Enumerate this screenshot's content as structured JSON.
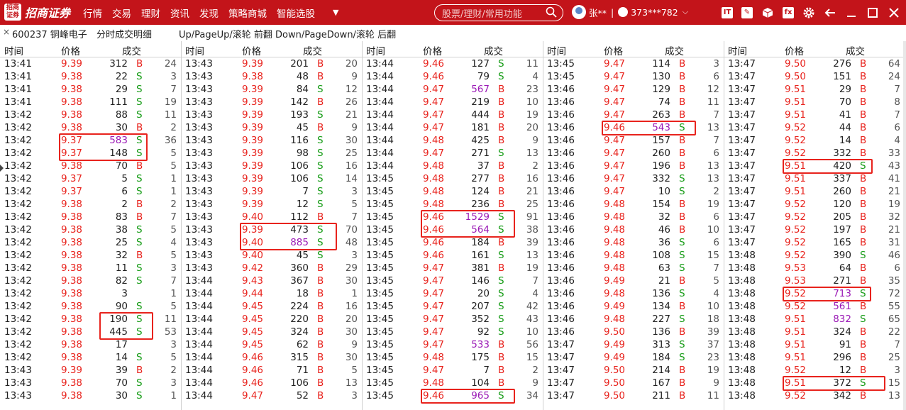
{
  "app": {
    "brand": "招商证券",
    "logo_mark": "招商证券"
  },
  "nav": [
    "行情",
    "交易",
    "理财",
    "资讯",
    "发现",
    "策略商城",
    "智能选股"
  ],
  "search": {
    "placeholder": "股票/理财/常用功能"
  },
  "user": {
    "name": "张**",
    "account": "373***782"
  },
  "toolbar_icons": [
    "it-icon",
    "chart-icon",
    "cube-icon",
    "fx-icon",
    "gear-icon",
    "back-arrow-icon",
    "minimize-icon",
    "maximize-icon",
    "close-icon"
  ],
  "subheader": {
    "close": "×",
    "stock": "600237 铜峰电子",
    "title": "分时成交明细",
    "hint": "Up/PageUp/滚轮 前翻 Down/PageDown/滚轮 后翻"
  },
  "headers": {
    "time": "时间",
    "price": "价格",
    "volume": "成交"
  },
  "colors": {
    "up": "#e8231d",
    "down": "#169c16",
    "large": "#9b1ab6",
    "brand": "#c3141a"
  },
  "panels": [
    {
      "rows": [
        [
          "13:41",
          "9.39",
          "312",
          "B",
          "24"
        ],
        [
          "13:41",
          "9.38",
          "22",
          "S",
          "3"
        ],
        [
          "13:41",
          "9.38",
          "29",
          "S",
          "7"
        ],
        [
          "13:41",
          "9.38",
          "111",
          "S",
          "19"
        ],
        [
          "13:42",
          "9.38",
          "88",
          "S",
          "11"
        ],
        [
          "13:42",
          "9.38",
          "30",
          "B",
          "2"
        ],
        [
          "13:42",
          "9.37",
          "583",
          "S",
          "36"
        ],
        [
          "13:42",
          "9.37",
          "148",
          "S",
          "5"
        ],
        [
          "13:42",
          "9.38",
          "70",
          "B",
          "5"
        ],
        [
          "13:42",
          "9.37",
          "5",
          "S",
          "1"
        ],
        [
          "13:42",
          "9.37",
          "6",
          "S",
          "1"
        ],
        [
          "13:42",
          "9.38",
          "2",
          "B",
          "2"
        ],
        [
          "13:42",
          "9.38",
          "83",
          "B",
          "7"
        ],
        [
          "13:42",
          "9.38",
          "38",
          "S",
          "5"
        ],
        [
          "13:42",
          "9.38",
          "25",
          "S",
          "4"
        ],
        [
          "13:42",
          "9.38",
          "32",
          "B",
          "5"
        ],
        [
          "13:42",
          "9.38",
          "11",
          "S",
          "3"
        ],
        [
          "13:42",
          "9.38",
          "82",
          "S",
          "7"
        ],
        [
          "13:42",
          "9.38",
          "3",
          "",
          "1"
        ],
        [
          "13:42",
          "9.38",
          "90",
          "S",
          "5"
        ],
        [
          "13:42",
          "9.38",
          "190",
          "S",
          "11"
        ],
        [
          "13:42",
          "9.38",
          "445",
          "S",
          "53"
        ],
        [
          "13:42",
          "9.38",
          "17",
          "",
          "3"
        ],
        [
          "13:42",
          "9.38",
          "14",
          "S",
          "5"
        ],
        [
          "13:43",
          "9.39",
          "39",
          "B",
          "2"
        ],
        [
          "13:43",
          "9.38",
          "70",
          "S",
          "3"
        ],
        [
          "13:43",
          "9.38",
          "30",
          "S",
          "1"
        ]
      ]
    },
    {
      "rows": [
        [
          "13:43",
          "9.39",
          "201",
          "B",
          "20"
        ],
        [
          "13:43",
          "9.38",
          "48",
          "B",
          "9"
        ],
        [
          "13:43",
          "9.39",
          "84",
          "S",
          "12"
        ],
        [
          "13:43",
          "9.39",
          "142",
          "B",
          "26"
        ],
        [
          "13:43",
          "9.39",
          "193",
          "S",
          "21"
        ],
        [
          "13:43",
          "9.39",
          "45",
          "B",
          "9"
        ],
        [
          "13:43",
          "9.39",
          "116",
          "S",
          "30"
        ],
        [
          "13:43",
          "9.39",
          "98",
          "S",
          "25"
        ],
        [
          "13:43",
          "9.39",
          "106",
          "S",
          "16"
        ],
        [
          "13:43",
          "9.39",
          "106",
          "S",
          "14"
        ],
        [
          "13:43",
          "9.39",
          "7",
          "S",
          "3"
        ],
        [
          "13:43",
          "9.39",
          "12",
          "S",
          "5"
        ],
        [
          "13:43",
          "9.40",
          "112",
          "B",
          "7"
        ],
        [
          "13:43",
          "9.39",
          "473",
          "S",
          "70"
        ],
        [
          "13:43",
          "9.40",
          "885",
          "S",
          "48"
        ],
        [
          "13:43",
          "9.40",
          "45",
          "S",
          "3"
        ],
        [
          "13:43",
          "9.42",
          "360",
          "B",
          "29"
        ],
        [
          "13:44",
          "9.43",
          "367",
          "B",
          "30"
        ],
        [
          "13:44",
          "9.44",
          "18",
          "B",
          "1"
        ],
        [
          "13:44",
          "9.45",
          "224",
          "B",
          "16"
        ],
        [
          "13:44",
          "9.45",
          "220",
          "B",
          "20"
        ],
        [
          "13:44",
          "9.45",
          "324",
          "B",
          "30"
        ],
        [
          "13:44",
          "9.45",
          "62",
          "B",
          "9"
        ],
        [
          "13:44",
          "9.46",
          "315",
          "B",
          "30"
        ],
        [
          "13:44",
          "9.46",
          "71",
          "B",
          "5"
        ],
        [
          "13:44",
          "9.46",
          "106",
          "B",
          "13"
        ],
        [
          "13:44",
          "9.47",
          "52",
          "B",
          "3"
        ]
      ]
    },
    {
      "rows": [
        [
          "13:44",
          "9.46",
          "127",
          "S",
          "11"
        ],
        [
          "13:44",
          "9.46",
          "79",
          "S",
          "4"
        ],
        [
          "13:44",
          "9.47",
          "567",
          "B",
          "23"
        ],
        [
          "13:44",
          "9.47",
          "219",
          "B",
          "10"
        ],
        [
          "13:44",
          "9.47",
          "444",
          "B",
          "19"
        ],
        [
          "13:44",
          "9.47",
          "181",
          "B",
          "20"
        ],
        [
          "13:44",
          "9.48",
          "425",
          "B",
          "9"
        ],
        [
          "13:44",
          "9.47",
          "271",
          "S",
          "13"
        ],
        [
          "13:44",
          "9.48",
          "37",
          "B",
          "2"
        ],
        [
          "13:45",
          "9.48",
          "277",
          "B",
          "16"
        ],
        [
          "13:45",
          "9.48",
          "124",
          "B",
          "21"
        ],
        [
          "13:45",
          "9.48",
          "236",
          "B",
          "25"
        ],
        [
          "13:45",
          "9.46",
          "1529",
          "S",
          "91"
        ],
        [
          "13:45",
          "9.46",
          "564",
          "S",
          "38"
        ],
        [
          "13:45",
          "9.46",
          "184",
          "B",
          "39"
        ],
        [
          "13:45",
          "9.46",
          "161",
          "S",
          "13"
        ],
        [
          "13:45",
          "9.47",
          "381",
          "B",
          "19"
        ],
        [
          "13:45",
          "9.47",
          "146",
          "S",
          "7"
        ],
        [
          "13:45",
          "9.47",
          "20",
          "S",
          "4"
        ],
        [
          "13:45",
          "9.47",
          "207",
          "S",
          "42"
        ],
        [
          "13:45",
          "9.47",
          "352",
          "S",
          "43"
        ],
        [
          "13:45",
          "9.47",
          "92",
          "S",
          "10"
        ],
        [
          "13:45",
          "9.47",
          "533",
          "B",
          "56"
        ],
        [
          "13:45",
          "9.48",
          "175",
          "B",
          "15"
        ],
        [
          "13:45",
          "9.47",
          "7",
          "B",
          "2"
        ],
        [
          "13:45",
          "9.48",
          "104",
          "B",
          "9"
        ],
        [
          "13:45",
          "9.46",
          "965",
          "S",
          "34"
        ]
      ]
    },
    {
      "rows": [
        [
          "13:45",
          "9.47",
          "114",
          "B",
          "3"
        ],
        [
          "13:45",
          "9.47",
          "130",
          "B",
          "6"
        ],
        [
          "13:46",
          "9.47",
          "129",
          "B",
          "12"
        ],
        [
          "13:46",
          "9.47",
          "74",
          "B",
          "11"
        ],
        [
          "13:46",
          "9.47",
          "263",
          "B",
          "7"
        ],
        [
          "13:46",
          "9.46",
          "543",
          "S",
          "13"
        ],
        [
          "13:46",
          "9.47",
          "157",
          "B",
          "7"
        ],
        [
          "13:46",
          "9.47",
          "260",
          "B",
          "6"
        ],
        [
          "13:46",
          "9.47",
          "196",
          "B",
          "13"
        ],
        [
          "13:46",
          "9.47",
          "332",
          "S",
          "13"
        ],
        [
          "13:46",
          "9.47",
          "10",
          "S",
          "2"
        ],
        [
          "13:46",
          "9.48",
          "154",
          "B",
          "19"
        ],
        [
          "13:46",
          "9.48",
          "32",
          "B",
          "6"
        ],
        [
          "13:46",
          "9.48",
          "46",
          "B",
          "10"
        ],
        [
          "13:46",
          "9.48",
          "36",
          "S",
          "6"
        ],
        [
          "13:46",
          "9.48",
          "108",
          "S",
          "15"
        ],
        [
          "13:46",
          "9.48",
          "63",
          "S",
          "7"
        ],
        [
          "13:46",
          "9.49",
          "21",
          "B",
          "5"
        ],
        [
          "13:46",
          "9.48",
          "136",
          "S",
          "4"
        ],
        [
          "13:46",
          "9.49",
          "134",
          "B",
          "10"
        ],
        [
          "13:46",
          "9.48",
          "227",
          "S",
          "18"
        ],
        [
          "13:46",
          "9.50",
          "136",
          "B",
          "39"
        ],
        [
          "13:47",
          "9.49",
          "313",
          "S",
          "37"
        ],
        [
          "13:47",
          "9.49",
          "184",
          "S",
          "23"
        ],
        [
          "13:47",
          "9.50",
          "214",
          "B",
          "19"
        ],
        [
          "13:47",
          "9.50",
          "167",
          "B",
          "9"
        ],
        [
          "13:47",
          "9.50",
          "211",
          "B",
          "11"
        ]
      ]
    },
    {
      "rows": [
        [
          "13:47",
          "9.50",
          "276",
          "B",
          "64"
        ],
        [
          "13:47",
          "9.50",
          "151",
          "B",
          "24"
        ],
        [
          "13:47",
          "9.51",
          "29",
          "B",
          "7"
        ],
        [
          "13:47",
          "9.51",
          "70",
          "B",
          "8"
        ],
        [
          "13:47",
          "9.51",
          "41",
          "B",
          "7"
        ],
        [
          "13:47",
          "9.52",
          "44",
          "B",
          "6"
        ],
        [
          "13:47",
          "9.52",
          "14",
          "B",
          "4"
        ],
        [
          "13:47",
          "9.52",
          "332",
          "B",
          "33"
        ],
        [
          "13:47",
          "9.51",
          "420",
          "S",
          "43"
        ],
        [
          "13:47",
          "9.51",
          "337",
          "B",
          "41"
        ],
        [
          "13:47",
          "9.51",
          "260",
          "B",
          "21"
        ],
        [
          "13:47",
          "9.52",
          "120",
          "B",
          "19"
        ],
        [
          "13:47",
          "9.52",
          "205",
          "B",
          "32"
        ],
        [
          "13:47",
          "9.52",
          "197",
          "B",
          "21"
        ],
        [
          "13:47",
          "9.52",
          "165",
          "B",
          "31"
        ],
        [
          "13:48",
          "9.52",
          "390",
          "S",
          "46"
        ],
        [
          "13:48",
          "9.53",
          "64",
          "B",
          "6"
        ],
        [
          "13:48",
          "9.53",
          "271",
          "B",
          "35"
        ],
        [
          "13:48",
          "9.52",
          "713",
          "S",
          "72"
        ],
        [
          "13:48",
          "9.52",
          "561",
          "B",
          "55"
        ],
        [
          "13:48",
          "9.51",
          "832",
          "S",
          "65"
        ],
        [
          "13:48",
          "9.51",
          "324",
          "B",
          "22"
        ],
        [
          "13:48",
          "9.51",
          "91",
          "B",
          "7"
        ],
        [
          "13:48",
          "9.51",
          "296",
          "B",
          "25"
        ],
        [
          "13:48",
          "9.52",
          "12",
          "B",
          "3"
        ],
        [
          "13:48",
          "9.51",
          "372",
          "S",
          "15"
        ],
        [
          "13:48",
          "9.52",
          "342",
          "B",
          "13"
        ]
      ]
    }
  ]
}
